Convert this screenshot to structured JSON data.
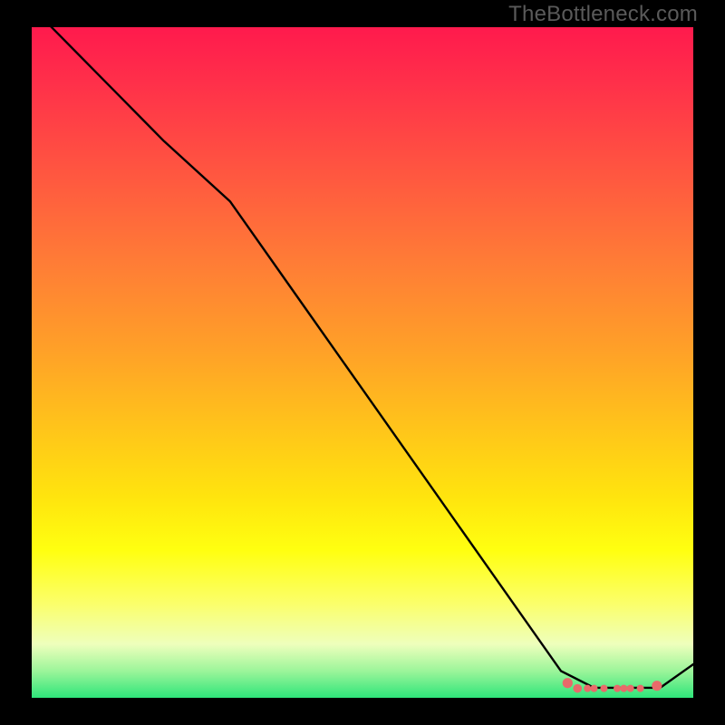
{
  "watermark": "TheBottleneck.com",
  "chart_data": {
    "type": "line",
    "title": "",
    "xlabel": "",
    "ylabel": "",
    "xlim": [
      0,
      100
    ],
    "ylim": [
      0,
      100
    ],
    "grid": false,
    "legend": false,
    "series": [
      {
        "name": "curve",
        "x": [
          0,
          10,
          20,
          30,
          40,
          50,
          60,
          70,
          80,
          85,
          90,
          95,
          100
        ],
        "y": [
          103,
          93,
          83,
          74,
          60,
          46,
          32,
          18,
          4,
          1.5,
          1.5,
          1.5,
          5
        ]
      }
    ],
    "markers": [
      {
        "x": 81,
        "y": 2.2,
        "r": 1.4
      },
      {
        "x": 82.5,
        "y": 1.4,
        "r": 1.2
      },
      {
        "x": 84,
        "y": 1.4,
        "r": 1.0
      },
      {
        "x": 85,
        "y": 1.4,
        "r": 1.0
      },
      {
        "x": 86.5,
        "y": 1.4,
        "r": 1.0
      },
      {
        "x": 88.5,
        "y": 1.4,
        "r": 1.0
      },
      {
        "x": 89.5,
        "y": 1.4,
        "r": 1.0
      },
      {
        "x": 90.5,
        "y": 1.4,
        "r": 1.0
      },
      {
        "x": 92,
        "y": 1.4,
        "r": 1.0
      },
      {
        "x": 94.5,
        "y": 1.8,
        "r": 1.4
      }
    ],
    "gradient_stops": [
      {
        "pos": 0,
        "color": "#ff1a4d"
      },
      {
        "pos": 22,
        "color": "#ff5740"
      },
      {
        "pos": 48,
        "color": "#ffa028"
      },
      {
        "pos": 70,
        "color": "#ffe40e"
      },
      {
        "pos": 86,
        "color": "#fbff6b"
      },
      {
        "pos": 96,
        "color": "#9cf59a"
      },
      {
        "pos": 100,
        "color": "#2ee57a"
      }
    ]
  }
}
